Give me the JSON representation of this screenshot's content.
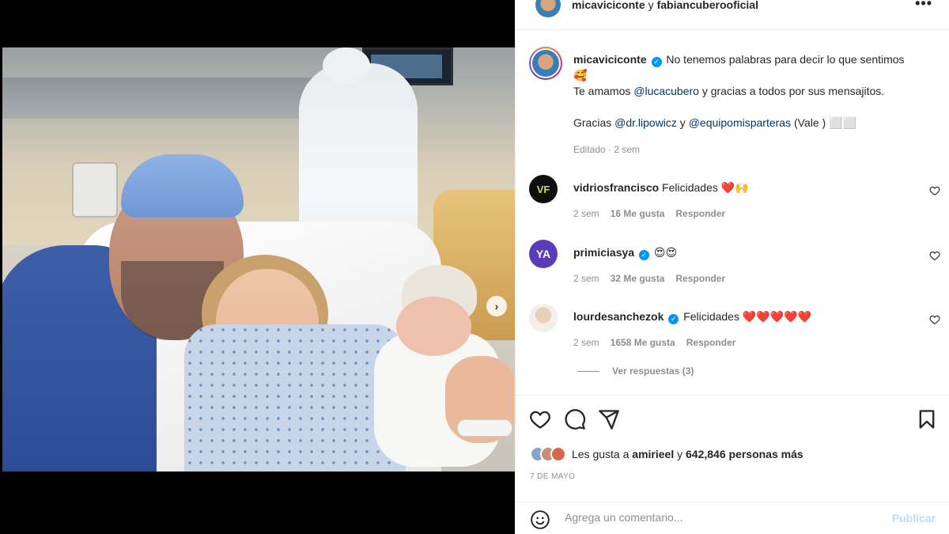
{
  "header": {
    "user1": "micaviciconte",
    "connector": "y",
    "user2": "fabiancuberooficial"
  },
  "caption": {
    "username": "micaviciconte",
    "line1": "No tenemos palabras para decir lo que sentimos",
    "line1_emoji": "🥰",
    "line2_a": "Te amamos ",
    "line2_mention": "@lucacubero",
    "line2_b": " y gracias a todos por sus mensajitos.",
    "line3_a": "Gracias ",
    "line3_mention1": "@dr.lipowicz",
    "line3_b": " y ",
    "line3_mention2": "@equipomisparteras",
    "line3_c": " (Vale ) ⬜⬜",
    "meta": "Editado · 2 sem"
  },
  "comments": [
    {
      "username": "vidriosfrancisco",
      "verified": false,
      "text": "Felicidades",
      "emoji": "❤️🙌",
      "avatar_label": "VF",
      "time": "2 sem",
      "likes": "16 Me gusta",
      "reply": "Responder"
    },
    {
      "username": "primiciasya",
      "verified": true,
      "text": "",
      "emoji": "😍😍",
      "avatar_label": "YA",
      "time": "2 sem",
      "likes": "32 Me gusta",
      "reply": "Responder"
    },
    {
      "username": "lourdesanchezok",
      "verified": true,
      "text": "Felicidades",
      "emoji": "❤️❤️❤️❤️❤️",
      "avatar_label": "",
      "time": "2 sem",
      "likes": "1658 Me gusta",
      "reply": "Responder"
    }
  ],
  "replies_link": "Ver respuestas (3)",
  "likes": {
    "prefix": "Les gusta a ",
    "user": "amirieel",
    "middle": " y ",
    "count": "642,846 personas más"
  },
  "date": "7 DE MAYO",
  "add_comment": {
    "placeholder": "Agrega un comentario...",
    "publish": "Publicar"
  },
  "icons": {
    "more": "more-horizontal-icon",
    "like": "heart-icon",
    "comment": "comment-icon",
    "share": "share-icon",
    "save": "bookmark-icon",
    "emoji": "emoji-icon",
    "verified": "verified-badge-icon",
    "next": "chevron-right-icon"
  },
  "colors": {
    "link": "#00376b",
    "secondary_text": "#8e8e8e",
    "verified": "#0095f6",
    "publish_disabled": "#b2dffc",
    "heart": "#ed4956"
  },
  "carousel": {
    "slides": 2,
    "current": 1
  }
}
